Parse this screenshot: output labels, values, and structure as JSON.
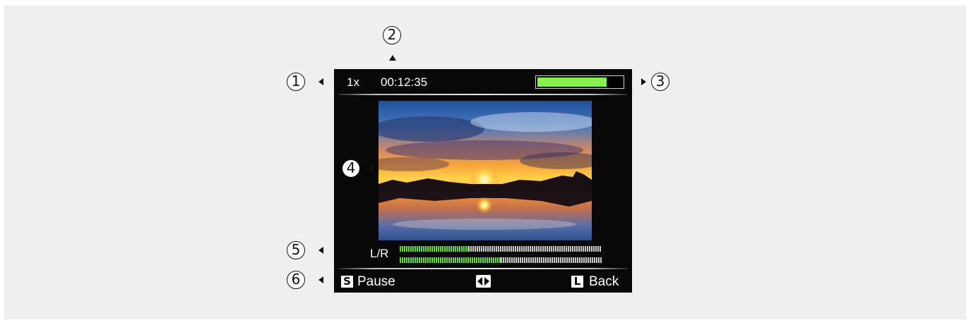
{
  "screen": {
    "speed": "1x",
    "timecode": "00:12:35",
    "battery_level": 0.82,
    "battery_color": "#86f04e",
    "photo_description_icon": "sunset-lake-photo",
    "audio": {
      "label": "L/R",
      "left_level": 0.34,
      "right_level": 0.5,
      "lit_color": "#62e03a"
    },
    "controls": {
      "pause_key": "S",
      "pause_label": "Pause",
      "nav_icon": "left-right-arrows-icon",
      "back_key": "L",
      "back_label": "Back"
    }
  },
  "callouts": [
    "1",
    "2",
    "3",
    "4",
    "5",
    "6"
  ]
}
